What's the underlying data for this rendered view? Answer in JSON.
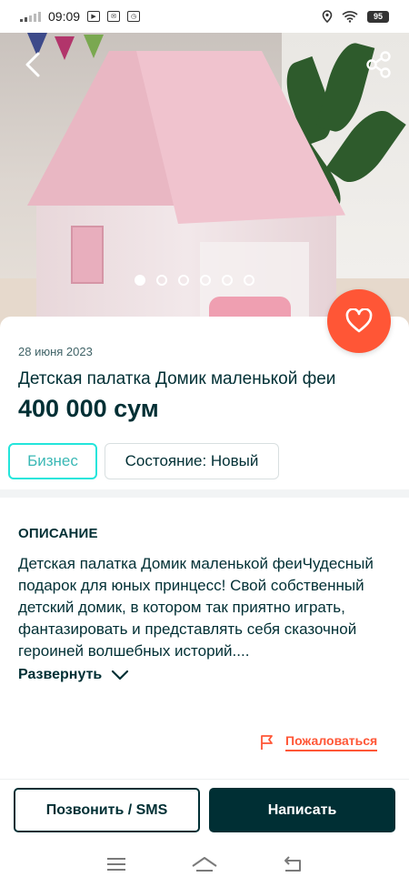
{
  "status_bar": {
    "time": "09:09",
    "battery": "95"
  },
  "gallery": {
    "image_alt": "Детская палатка Домик маленькой феи",
    "dots": [
      true,
      false,
      false,
      false,
      false,
      false
    ],
    "back_icon": "chevron-left-icon",
    "share_icon": "share-icon"
  },
  "listing": {
    "date": "28 июня 2023",
    "title": "Детская палатка Домик маленькой феи",
    "price": "400 000 сум",
    "favorite_icon": "heart-icon",
    "accent_color": "#ff5636"
  },
  "tags": {
    "business": "Бизнес",
    "condition": "Состояние: Новый"
  },
  "description": {
    "heading": "ОПИСАНИЕ",
    "text": "Детская палатка Домик маленькой феиЧудесный подарок для юных принцесс! Свой собственный детский домик, в котором так приятно играть, фантазировать и представлять себя сказочной героиней волшебных историй....",
    "expand_label": "Развернуть"
  },
  "report": {
    "label": "Пожаловаться"
  },
  "actions": {
    "call_label": "Позвонить / SMS",
    "write_label": "Написать",
    "primary_color": "#002f34"
  }
}
